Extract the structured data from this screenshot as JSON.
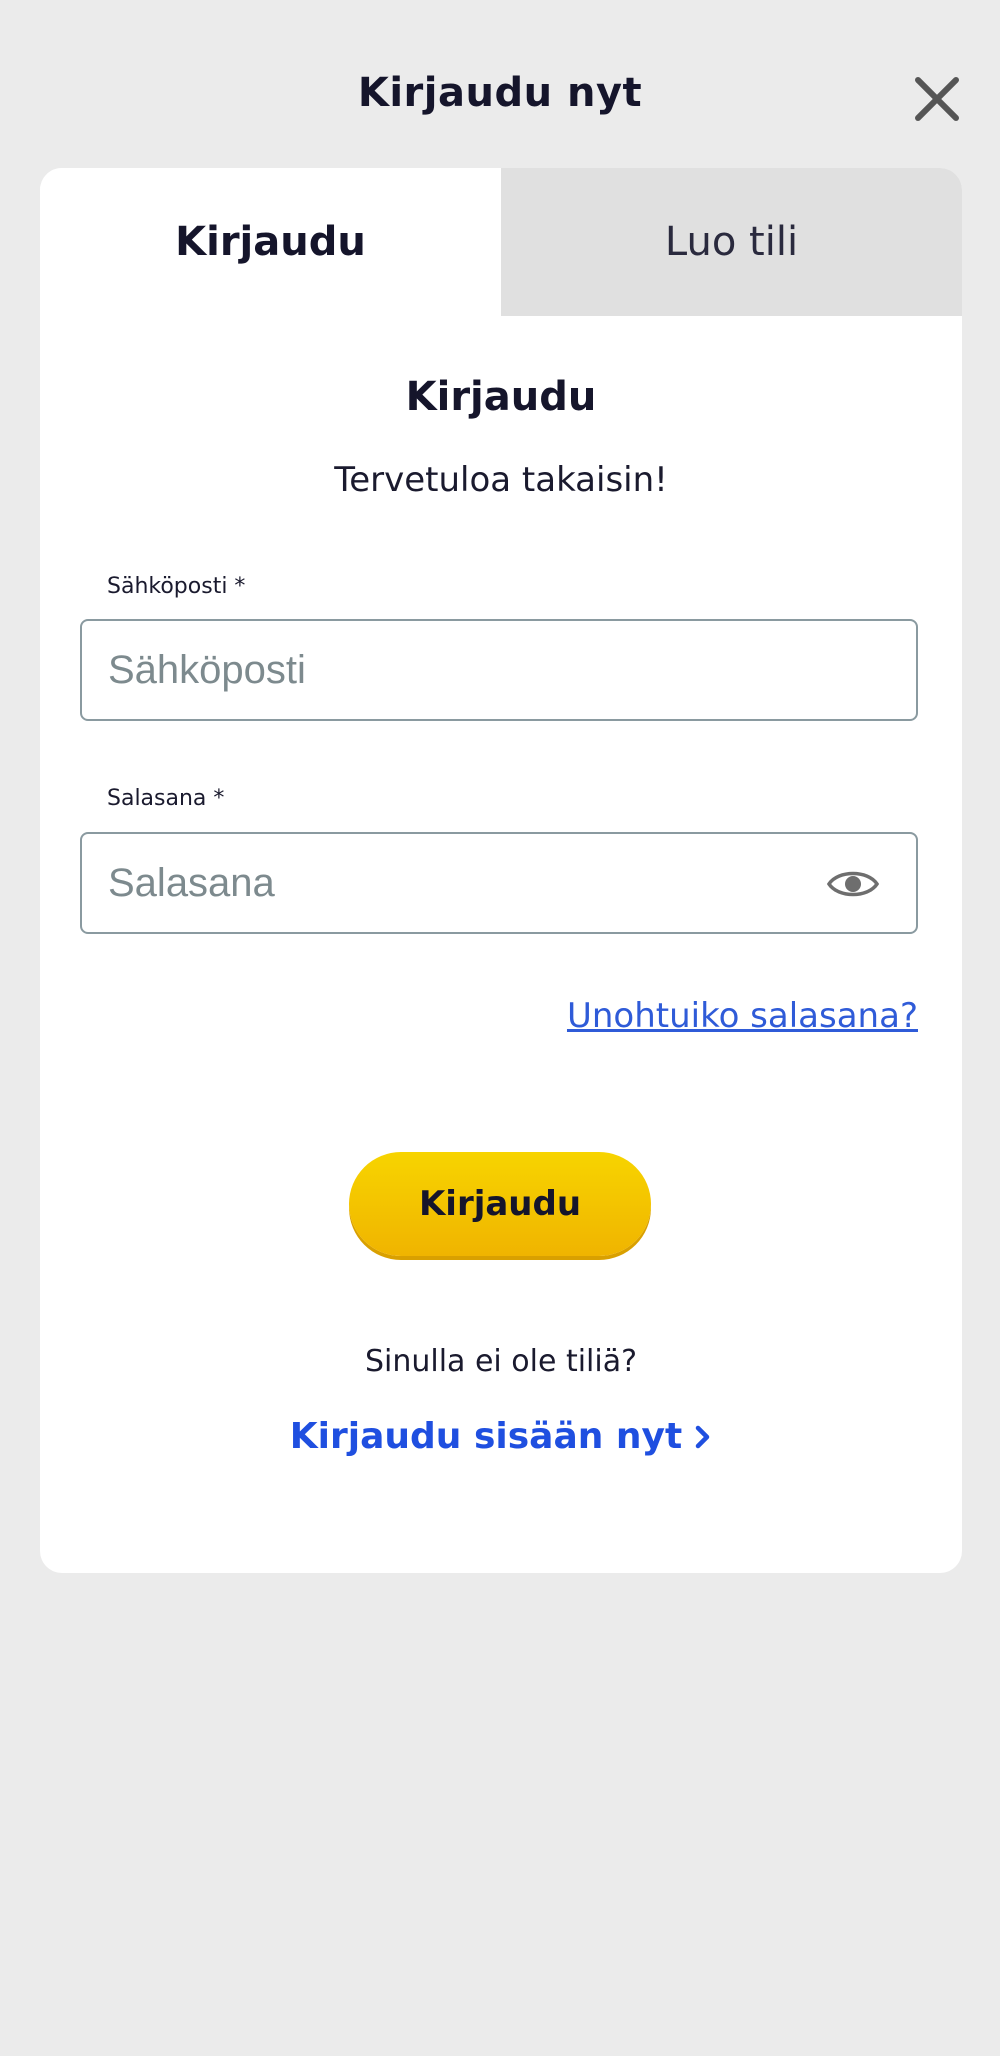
{
  "header": {
    "title": "Kirjaudu nyt",
    "close_icon": "close-icon"
  },
  "tabs": [
    {
      "label": "Kirjaudu",
      "active": true
    },
    {
      "label": "Luo tili",
      "active": false
    }
  ],
  "form": {
    "title": "Kirjaudu",
    "subtitle": "Tervetuloa takaisin!",
    "email": {
      "label": "Sähköposti *",
      "placeholder": "Sähköposti",
      "value": ""
    },
    "password": {
      "label": "Salasana *",
      "placeholder": "Salasana",
      "value": "",
      "toggle_icon": "eye-icon"
    },
    "forgot_password": "Unohtuiko salasana?",
    "submit_label": "Kirjaudu",
    "no_account_text": "Sinulla ei ole tiliä?",
    "signup_link": "Kirjaudu sisään nyt",
    "signup_icon": "chevron-right-icon"
  },
  "colors": {
    "background": "#ebebeb",
    "card": "#ffffff",
    "inactive_tab": "#e0e0e0",
    "button": "#f5c800",
    "link": "#2f5bd8",
    "signup_link": "#1f4fe0",
    "text": "#15152b"
  }
}
